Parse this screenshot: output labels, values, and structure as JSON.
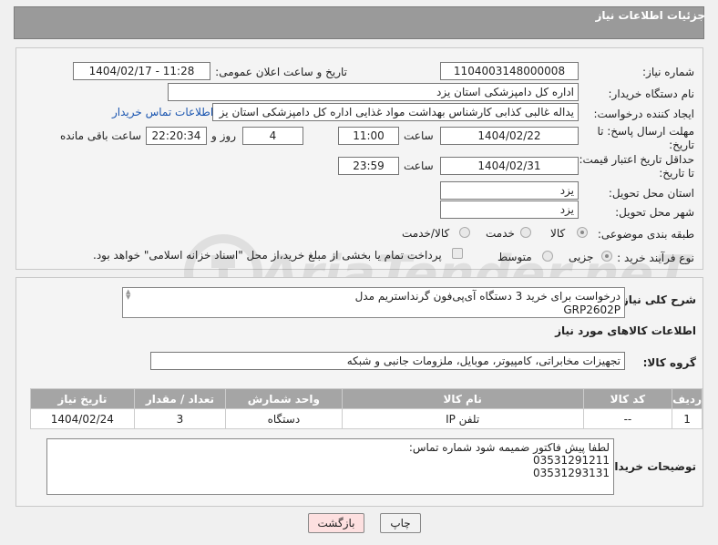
{
  "header": {
    "title": "جزئیات اطلاعات نیاز"
  },
  "form": {
    "need_number": {
      "label": "شماره نیاز:",
      "value": "1104003148000008"
    },
    "announce_datetime": {
      "label": "تاریخ و ساعت اعلان عمومی:",
      "value": "1404/02/17 - 11:28"
    },
    "buyer_org": {
      "label": "نام دستگاه خریدار:",
      "value": "اداره کل دامپزشکی استان یزد"
    },
    "requester": {
      "label": "ایجاد کننده درخواست:",
      "value": "یداله غالبی کذابی کارشناس بهداشت مواد غذایی اداره کل دامپزشکی استان یز",
      "contact_link": "اطلاعات تماس خریدار"
    },
    "reply_deadline": {
      "label_line1": "مهلت ارسال پاسخ: تا",
      "label_line2": "تاریخ:",
      "date": "1404/02/22",
      "time_label": "ساعت",
      "time": "11:00",
      "days": "4",
      "days_label": "روز و",
      "remaining": "22:20:34",
      "remaining_label": "ساعت باقی مانده"
    },
    "price_validity": {
      "label_line1": "حداقل تاریخ اعتبار قیمت:",
      "label_line2": "تا تاریخ:",
      "date": "1404/02/31",
      "time_label": "ساعت",
      "time": "23:59"
    },
    "delivery_province": {
      "label": "استان محل تحویل:",
      "value": "یزد"
    },
    "delivery_city": {
      "label": "شهر محل تحویل:",
      "value": "یزد"
    },
    "category": {
      "label": "طبقه بندی موضوعی:",
      "options": [
        "کالا",
        "خدمت",
        "کالا/خدمت"
      ],
      "selected": "کالا"
    },
    "purchase_process": {
      "label": "نوع فرآیند خرید :",
      "options": [
        "جزیی",
        "متوسط"
      ],
      "payment_note": "پرداخت تمام یا بخشی از مبلغ خرید،از محل \"اسناد خزانه اسلامی\" خواهد بود."
    }
  },
  "description": {
    "label": "شرح کلی نیاز:",
    "text_line1": "درخواست برای خرید 3 دستگاه آی‌پی‌فون گرنداستریم مدل",
    "text_line2": "GRP2602P"
  },
  "goods": {
    "section_title": "اطلاعات کالاهای مورد نیاز",
    "group_label": "گروه کالا:",
    "group_value": "تجهیزات مخابراتی، کامپیوتر، موبایل، ملزومات جانبی و شبکه",
    "table": {
      "headers": [
        "ردیف",
        "کد کالا",
        "نام کالا",
        "واحد شمارش",
        "تعداد / مقدار",
        "تاریخ نیاز"
      ],
      "rows": [
        [
          "1",
          "--",
          "تلفن IP",
          "دستگاه",
          "3",
          "1404/02/24"
        ]
      ]
    }
  },
  "buyer_notes": {
    "label": "توضیحات خریدار:",
    "line1": "لطفا پیش فاکتور ضمیمه شود  شماره تماس:",
    "line2": "03531291211",
    "line3": "03531293131"
  },
  "buttons": {
    "print": "چاپ",
    "back": "بازگشت"
  },
  "watermark": {
    "text": "AriaTender.neT"
  }
}
